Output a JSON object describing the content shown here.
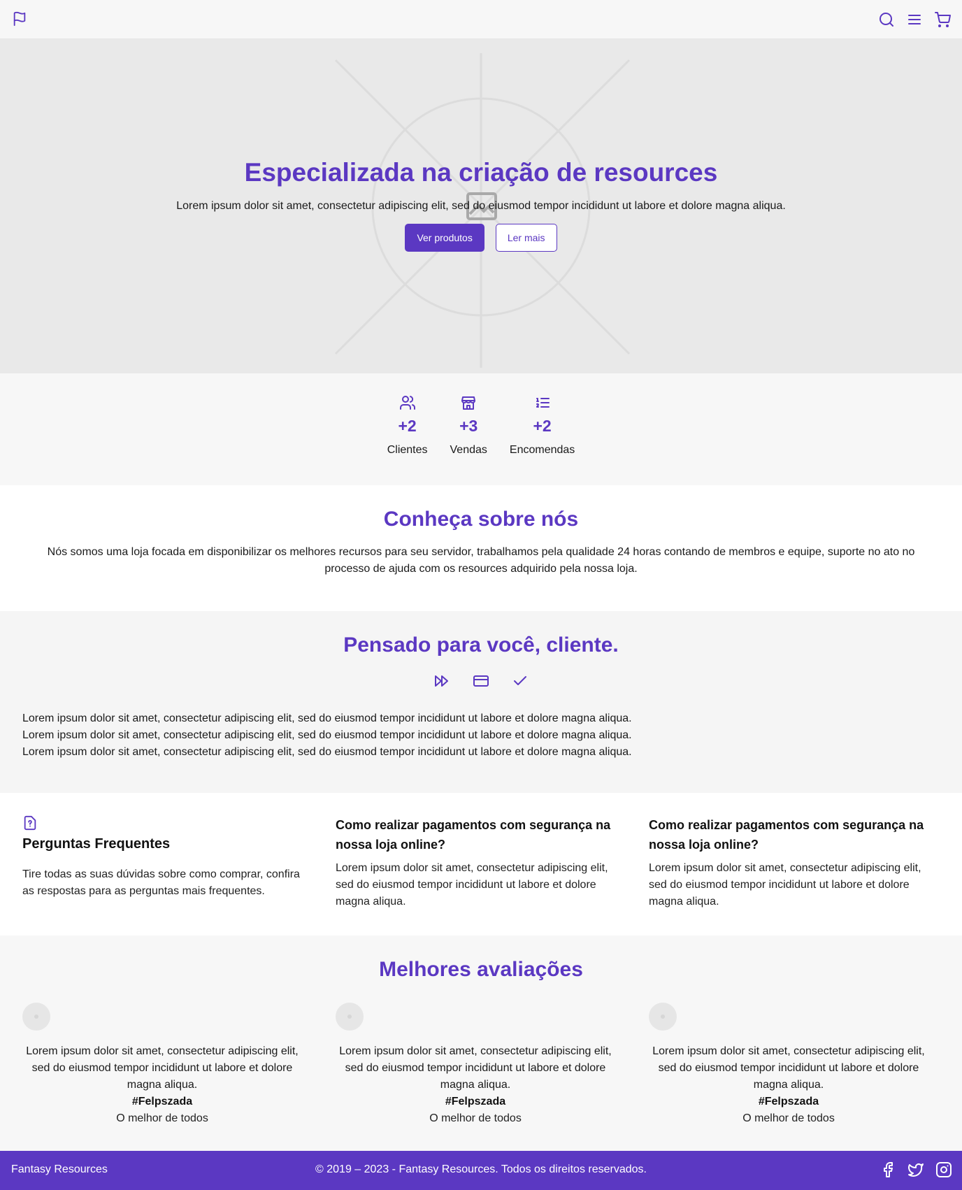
{
  "colors": {
    "accent": "#5b38c2",
    "hero_bg": "#e9e9e9",
    "footer_bg": "#5b38c2"
  },
  "nav": {
    "logo_icon": "flag-icon",
    "icons": [
      "search-icon",
      "menu-icon",
      "cart-icon"
    ]
  },
  "hero": {
    "title": "Especializada na criação de resources",
    "subtitle": "Lorem ipsum dolor sit amet, consectetur adipiscing elit, sed do eiusmod tempor incididunt ut labore et dolore magna aliqua.",
    "primary_button": "Ver produtos",
    "secondary_button": "Ler mais",
    "background_icon": "image-placeholder-icon"
  },
  "stats": [
    {
      "icon": "users-icon",
      "value": "+2",
      "label": "Clientes"
    },
    {
      "icon": "store-icon",
      "value": "+3",
      "label": "Vendas"
    },
    {
      "icon": "list-ordered-icon",
      "value": "+2",
      "label": "Encomendas"
    }
  ],
  "about": {
    "title": "Conheça sobre nós",
    "text": "Nós somos uma loja focada em disponibilizar os melhores recursos para seu servidor, trabalhamos pela qualidade 24 horas contando de membros e equipe, suporte no ato no processo de ajuda com os resources adquirido pela nossa loja."
  },
  "thought": {
    "title": "Pensado para você, cliente.",
    "icons": [
      "fast-forward-icon",
      "credit-card-icon",
      "check-icon"
    ],
    "lines": [
      "Lorem ipsum dolor sit amet, consectetur adipiscing elit, sed do eiusmod tempor incididunt ut labore et dolore magna aliqua.",
      "Lorem ipsum dolor sit amet, consectetur adipiscing elit, sed do eiusmod tempor incididunt ut labore et dolore magna aliqua.",
      "Lorem ipsum dolor sit amet, consectetur adipiscing elit, sed do eiusmod tempor incididunt ut labore et dolore magna aliqua."
    ]
  },
  "faq": {
    "icon": "file-question-icon",
    "title": "Perguntas Frequentes",
    "text": "Tire todas as suas dúvidas sobre como comprar, confira as respostas para as perguntas mais frequentes.",
    "items": [
      {
        "question": "Como realizar pagamentos com segurança na nossa loja online?",
        "answer": "Lorem ipsum dolor sit amet, consectetur adipiscing elit, sed do eiusmod tempor incididunt ut labore et dolore magna aliqua."
      },
      {
        "question": "Como realizar pagamentos com segurança na nossa loja online?",
        "answer": "Lorem ipsum dolor sit amet, consectetur adipiscing elit, sed do eiusmod tempor incididunt ut labore et dolore magna aliqua."
      }
    ]
  },
  "reviews": {
    "title": "Melhores avaliações",
    "items": [
      {
        "text": "Lorem ipsum dolor sit amet, consectetur adipiscing elit, sed do eiusmod tempor incididunt ut labore et dolore magna aliqua.",
        "handle": "#Felpszada",
        "role": "O melhor de todos"
      },
      {
        "text": "Lorem ipsum dolor sit amet, consectetur adipiscing elit, sed do eiusmod tempor incididunt ut labore et dolore magna aliqua.",
        "handle": "#Felpszada",
        "role": "O melhor de todos"
      },
      {
        "text": "Lorem ipsum dolor sit amet, consectetur adipiscing elit, sed do eiusmod tempor incididunt ut labore et dolore magna aliqua.",
        "handle": "#Felpszada",
        "role": "O melhor de todos"
      }
    ]
  },
  "footer": {
    "brand": "Fantasy Resources",
    "copyright": "© 2019 – 2023 - Fantasy Resources. Todos os direitos reservados.",
    "social_icons": [
      "facebook-icon",
      "twitter-icon",
      "instagram-icon"
    ]
  }
}
